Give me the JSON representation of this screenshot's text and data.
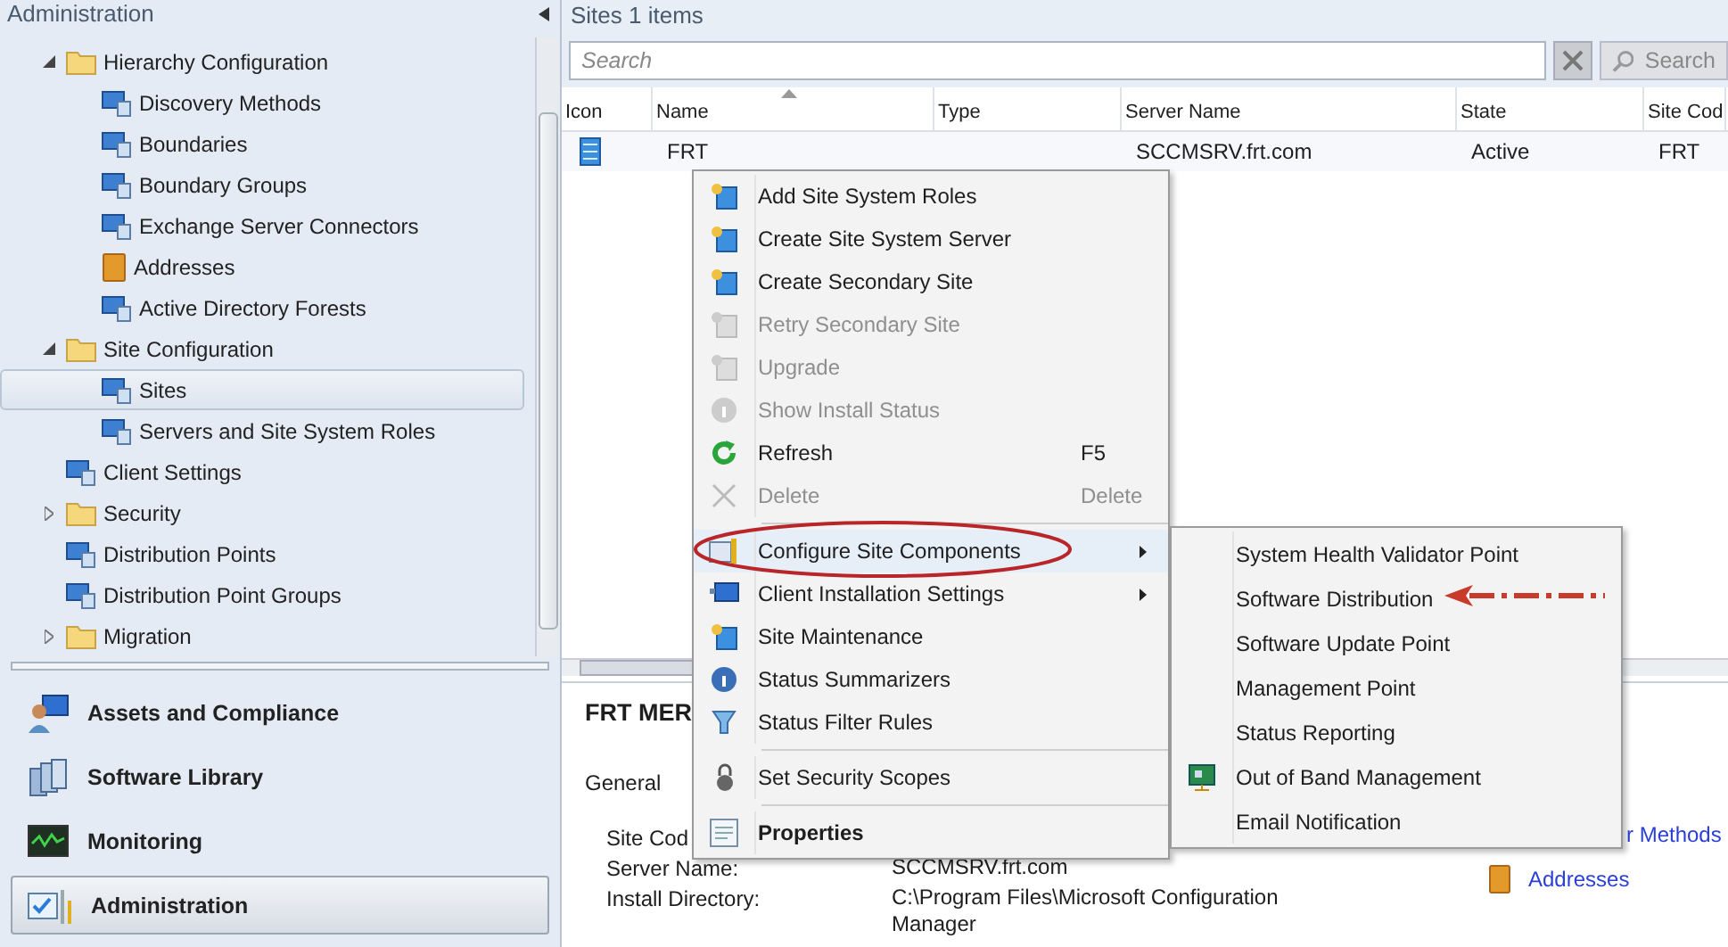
{
  "sidebar": {
    "title": "Administration",
    "tree": [
      {
        "label": "Hierarchy Configuration",
        "kind": "folder",
        "expanded": true,
        "selected": false,
        "children": [
          {
            "label": "Discovery Methods",
            "kind": "leaf",
            "selected": false
          },
          {
            "label": "Boundaries",
            "kind": "leaf",
            "selected": false
          },
          {
            "label": "Boundary Groups",
            "kind": "leaf",
            "selected": false
          },
          {
            "label": "Exchange Server Connectors",
            "kind": "leaf",
            "selected": false
          },
          {
            "label": "Addresses",
            "kind": "book",
            "selected": false
          },
          {
            "label": "Active Directory Forests",
            "kind": "leaf",
            "selected": false
          }
        ]
      },
      {
        "label": "Site Configuration",
        "kind": "folder",
        "expanded": true,
        "selected": false,
        "children": [
          {
            "label": "Sites",
            "kind": "leaf",
            "selected": true
          },
          {
            "label": "Servers and Site System Roles",
            "kind": "leaf",
            "selected": false
          }
        ]
      },
      {
        "label": "Client Settings",
        "kind": "leaf",
        "selected": false
      },
      {
        "label": "Security",
        "kind": "folder",
        "expanded": false,
        "selected": false
      },
      {
        "label": "Distribution Points",
        "kind": "leaf",
        "selected": false
      },
      {
        "label": "Distribution Point Groups",
        "kind": "leaf",
        "selected": false
      },
      {
        "label": "Migration",
        "kind": "folder",
        "expanded": false,
        "selected": false
      }
    ],
    "workspaces": [
      {
        "label": "Assets and Compliance",
        "selected": false
      },
      {
        "label": "Software Library",
        "selected": false
      },
      {
        "label": "Monitoring",
        "selected": false
      },
      {
        "label": "Administration",
        "selected": true
      }
    ]
  },
  "list": {
    "title": "Sites 1 items",
    "search": {
      "placeholder": "Search"
    },
    "search_button": "Search",
    "columns": [
      "Icon",
      "Name",
      "Type",
      "Server Name",
      "State",
      "Site Cod"
    ],
    "rows": [
      {
        "cells": [
          "",
          "FRT",
          "",
          "SCCMSRV.frt.com",
          "Active",
          "FRT"
        ]
      }
    ]
  },
  "details": {
    "title": "FRT MER",
    "tab": "General",
    "fields": [
      {
        "label": "Site Cod"
      },
      {
        "label": "Server Name:",
        "value": "SCCMSRV.frt.com"
      },
      {
        "label": "Install Directory:",
        "value": "C:\\Program Files\\Microsoft Configuration Manager"
      }
    ],
    "links": [
      {
        "label": "r Methods",
        "icon": false
      },
      {
        "label": "Addresses",
        "icon": true
      }
    ]
  },
  "context_menu": {
    "items": [
      {
        "label": "Add Site System Roles",
        "disabled": false
      },
      {
        "label": "Create Site System Server",
        "disabled": false
      },
      {
        "label": "Create Secondary Site",
        "disabled": false
      },
      {
        "label": "Retry Secondary Site",
        "disabled": true
      },
      {
        "label": "Upgrade",
        "disabled": true
      },
      {
        "label": "Show Install Status",
        "disabled": true
      },
      {
        "label": "Refresh",
        "shortcut": "F5",
        "disabled": false
      },
      {
        "label": "Delete",
        "shortcut": "Delete",
        "disabled": true,
        "separator_after": true
      },
      {
        "label": "Configure Site Components",
        "disabled": false,
        "submenu": true,
        "open": true
      },
      {
        "label": "Client Installation Settings",
        "disabled": false,
        "submenu": true
      },
      {
        "label": "Site Maintenance",
        "disabled": false
      },
      {
        "label": "Status Summarizers",
        "disabled": false
      },
      {
        "label": "Status Filter Rules",
        "disabled": false,
        "separator_after": true
      },
      {
        "label": "Set Security Scopes",
        "disabled": false,
        "separator_after": true
      },
      {
        "label": "Properties",
        "disabled": false,
        "bold": true
      }
    ]
  },
  "submenu": {
    "items": [
      {
        "label": "System Health Validator Point",
        "has_icon": false
      },
      {
        "label": "Software Distribution",
        "has_icon": false
      },
      {
        "label": "Software Update Point",
        "has_icon": false
      },
      {
        "label": "Management Point",
        "has_icon": false
      },
      {
        "label": "Status Reporting",
        "has_icon": false
      },
      {
        "label": "Out of Band Management",
        "has_icon": true
      },
      {
        "label": "Email Notification",
        "has_icon": false
      }
    ]
  }
}
